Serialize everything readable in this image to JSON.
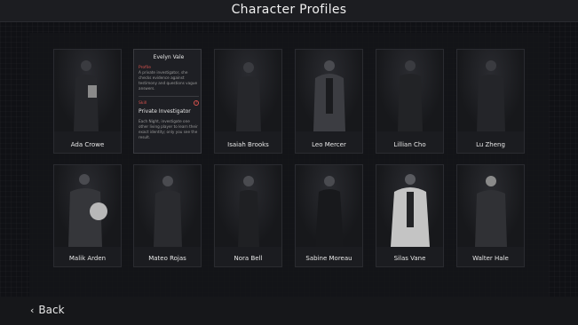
{
  "header": {
    "title": "Character Profiles"
  },
  "footer": {
    "back_label": "Back",
    "back_icon": "chevron-left-icon"
  },
  "selected": {
    "name": "Evelyn Vale",
    "profile_label": "Profile",
    "profile_text": "A private investigator, she checks evidence against testimony and questions vague answers.",
    "skill_label": "Skill",
    "skill_name": "Private Investigator",
    "skill_text": "Each Night, investigate one other living player to learn their exact identity; only you see the result."
  },
  "characters": [
    {
      "name": "Ada Crowe"
    },
    {
      "name": "Isaiah Brooks"
    },
    {
      "name": "Leo Mercer"
    },
    {
      "name": "Lillian Cho"
    },
    {
      "name": "Lu Zheng"
    },
    {
      "name": "Malik Arden"
    },
    {
      "name": "Mateo Rojas"
    },
    {
      "name": "Nora Bell"
    },
    {
      "name": "Sabine Moreau"
    },
    {
      "name": "Silas Vane"
    },
    {
      "name": "Walter Hale"
    }
  ],
  "colors": {
    "accent": "#d9534f",
    "card_bg": "#1b1c20",
    "page_bg": "#101115"
  }
}
